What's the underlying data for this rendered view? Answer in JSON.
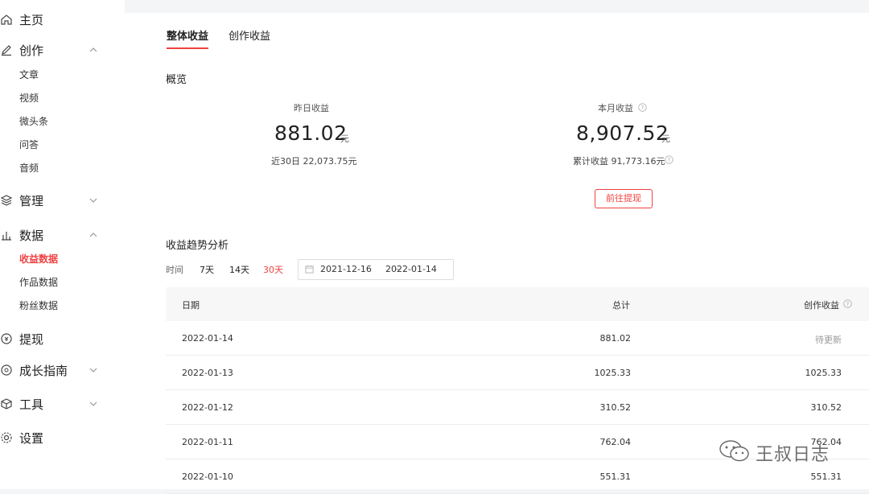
{
  "sidebar": {
    "home": "主页",
    "create": {
      "label": "创作",
      "items": [
        "文章",
        "视频",
        "微头条",
        "问答",
        "音频"
      ]
    },
    "manage": "管理",
    "data": {
      "label": "数据",
      "items": [
        "收益数据",
        "作品数据",
        "粉丝数据"
      ]
    },
    "withdraw": "提现",
    "growth": "成长指南",
    "tools": "工具",
    "settings": "设置"
  },
  "tabs": [
    "整体收益",
    "创作收益"
  ],
  "overview": {
    "title": "概览",
    "yesterday": {
      "label": "昨日收益",
      "value": "881.02",
      "unit": "元",
      "sub": "近30日 22,073.75元"
    },
    "month": {
      "label": "本月收益",
      "value": "8,907.52",
      "unit": "元",
      "sub": "累计收益 91,773.16元"
    },
    "withdraw_button": "前往提现"
  },
  "trend": {
    "title": "收益趋势分析",
    "time_label": "时间",
    "options": [
      "7天",
      "14天",
      "30天"
    ],
    "active_option": "30天",
    "date_start": "2021-12-16",
    "date_sep": "~",
    "date_end": "2022-01-14"
  },
  "table": {
    "headers": [
      "日期",
      "总计",
      "创作收益"
    ],
    "rows": [
      {
        "date": "2022-01-14",
        "total": "881.02",
        "creation": "待更新"
      },
      {
        "date": "2022-01-13",
        "total": "1025.33",
        "creation": "1025.33"
      },
      {
        "date": "2022-01-12",
        "total": "310.52",
        "creation": "310.52"
      },
      {
        "date": "2022-01-11",
        "total": "762.04",
        "creation": "762.04"
      },
      {
        "date": "2022-01-10",
        "total": "551.31",
        "creation": "551.31"
      }
    ]
  },
  "watermark": "王叔日志",
  "colors": {
    "accent": "#f04142",
    "background": "#f4f5f7",
    "panel": "#ffffff"
  }
}
